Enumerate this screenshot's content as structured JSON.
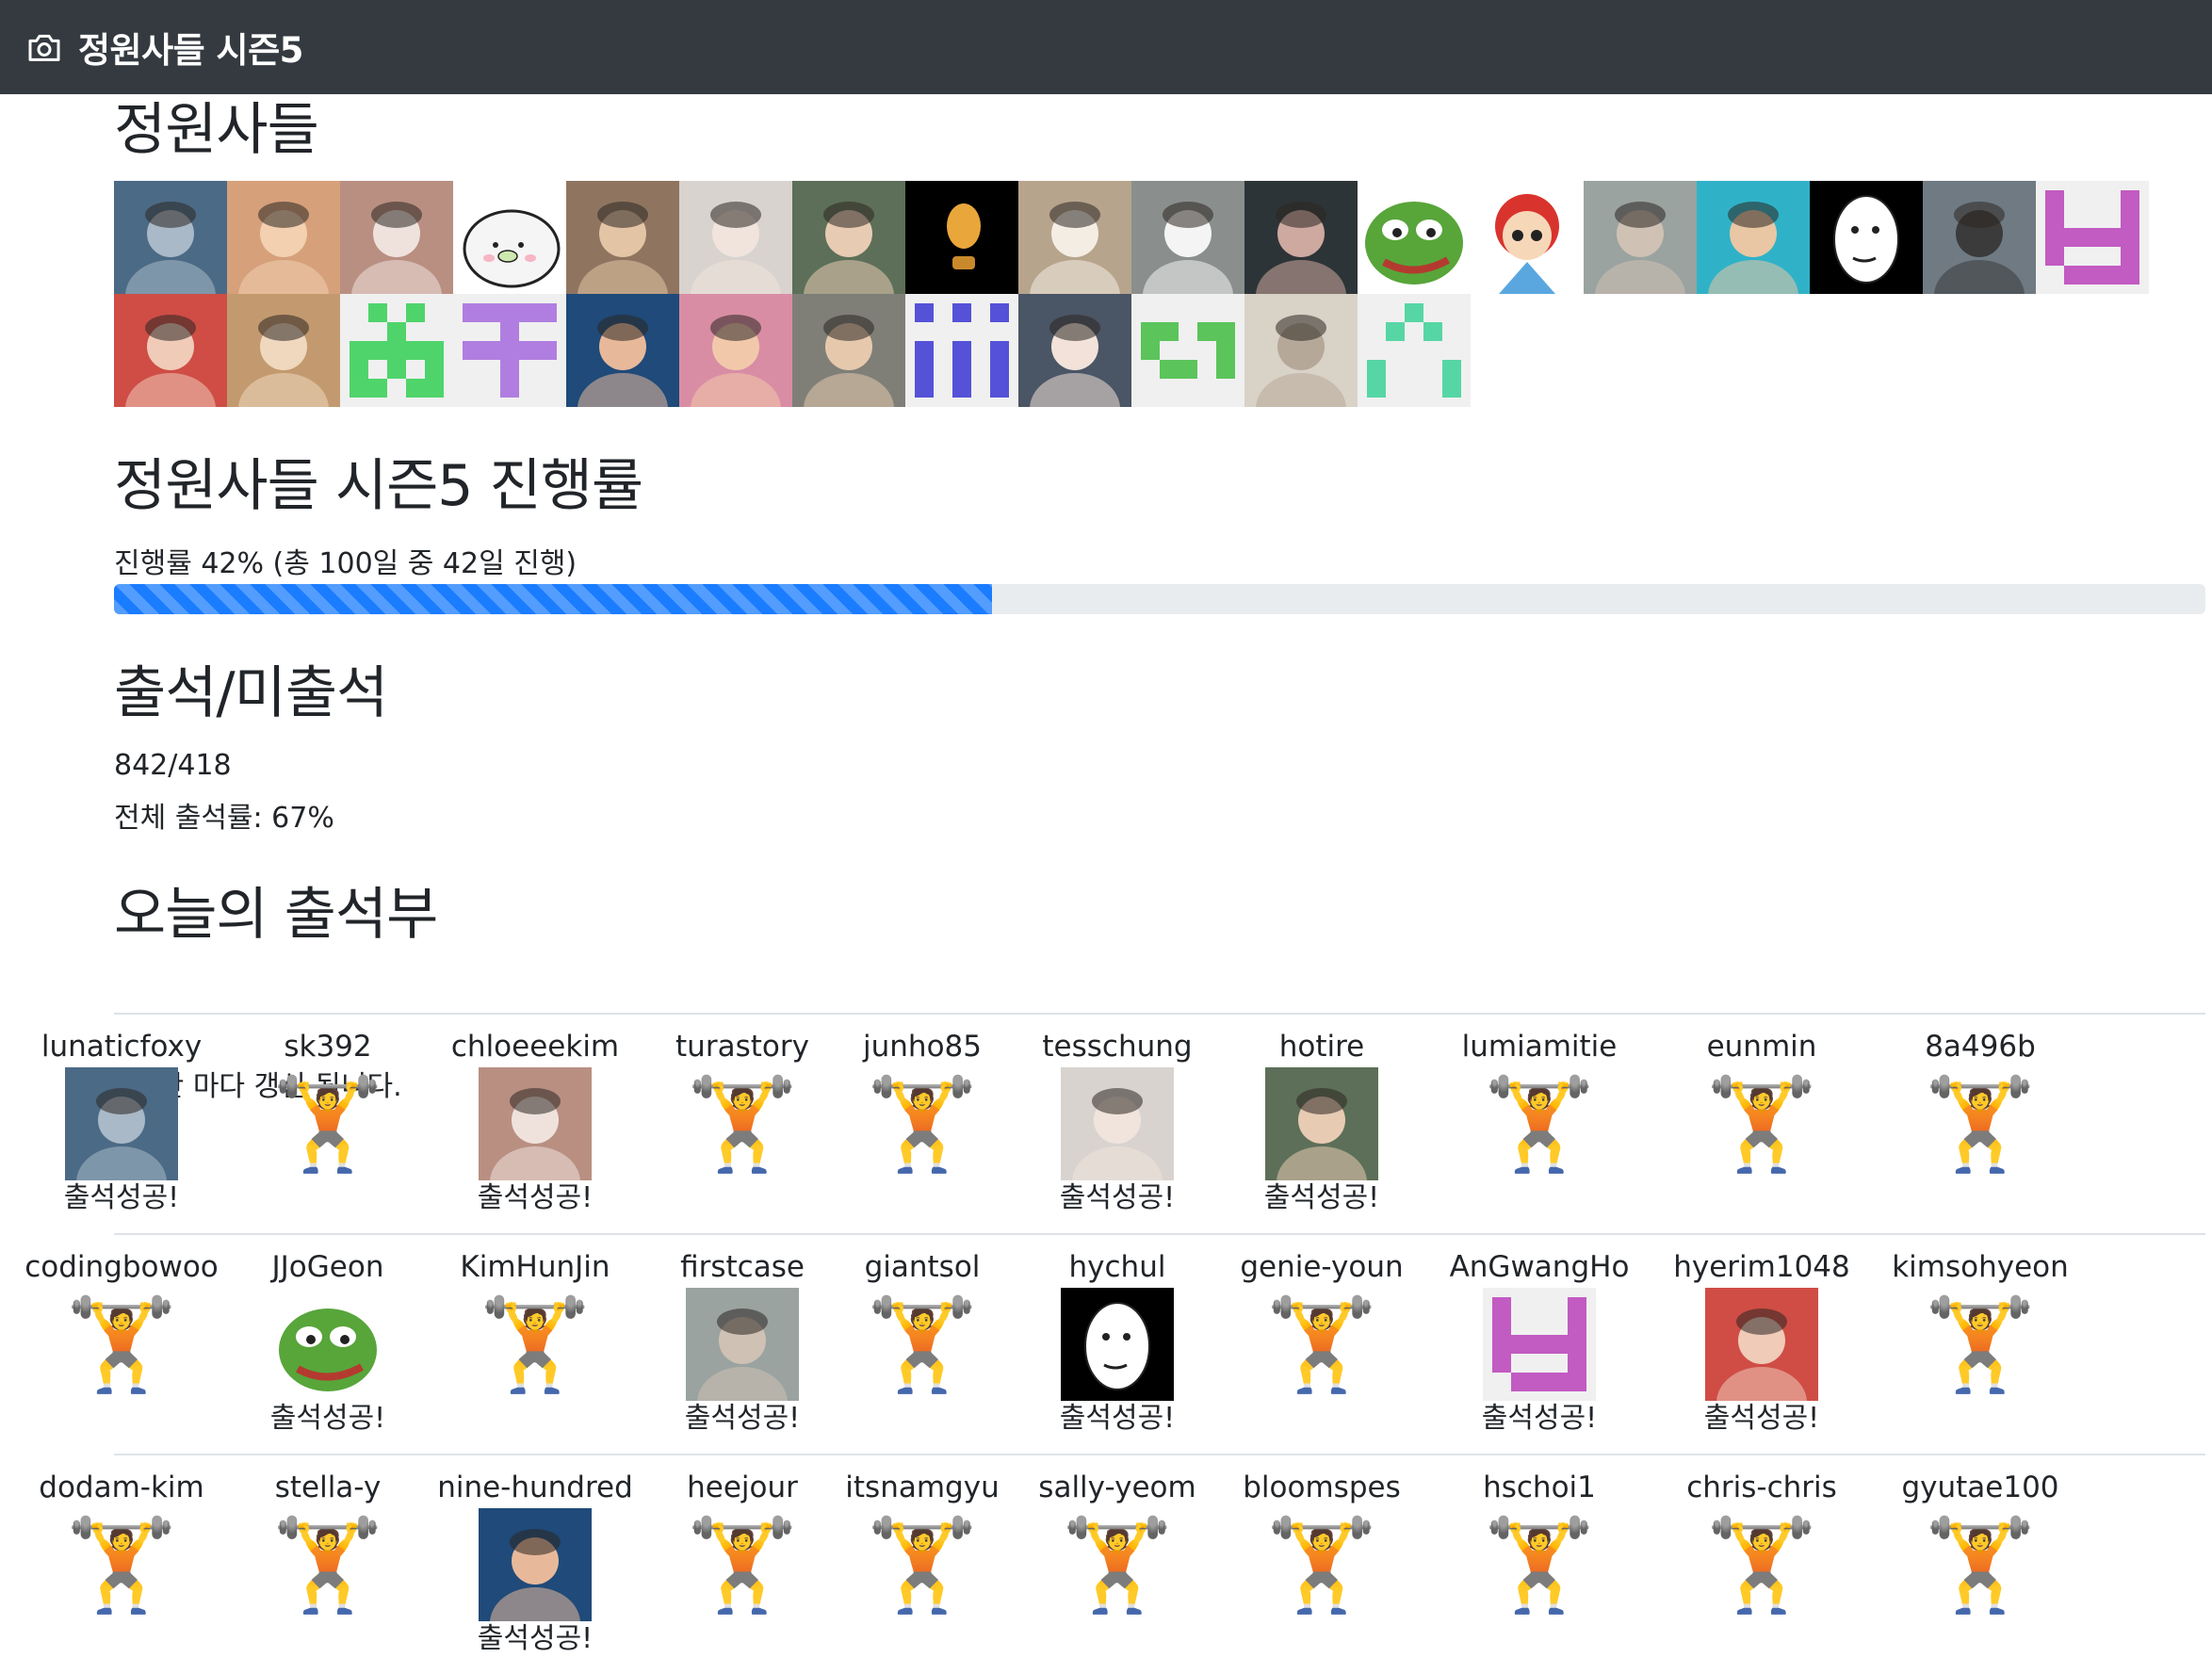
{
  "navbar": {
    "title": "정원사들 시즌5",
    "icon": "camera-icon"
  },
  "members": {
    "heading": "정원사들",
    "avatars": [
      {
        "kind": "photo",
        "bg": "#4b6a86",
        "fg": "#a9b9c7"
      },
      {
        "kind": "photo",
        "bg": "#d6a07a",
        "fg": "#f2d0b0"
      },
      {
        "kind": "photo",
        "bg": "#b98f82",
        "fg": "#efe2dc"
      },
      {
        "kind": "seal",
        "bg": "#ffffff",
        "fg": "#f2f2f2"
      },
      {
        "kind": "photo",
        "bg": "#8f7560",
        "fg": "#e3c4a4"
      },
      {
        "kind": "photo",
        "bg": "#d9d3cf",
        "fg": "#f1e4dc"
      },
      {
        "kind": "photo",
        "bg": "#5d6f58",
        "fg": "#e8cbb3"
      },
      {
        "kind": "dark",
        "bg": "#000000",
        "fg": "#e9a63a"
      },
      {
        "kind": "photo",
        "bg": "#b7a48d",
        "fg": "#f4ede4"
      },
      {
        "kind": "photo",
        "bg": "#8a8f8d",
        "fg": "#f4f4f4"
      },
      {
        "kind": "photo",
        "bg": "#2d3437",
        "fg": "#cda9a0"
      },
      {
        "kind": "pepe",
        "bg": "#ffffff",
        "fg": "#58a53a"
      },
      {
        "kind": "cartoon",
        "bg": "#ffffff",
        "fg": "#d9332d"
      },
      {
        "kind": "photo",
        "bg": "#9aa3a0",
        "fg": "#cfc1b4"
      },
      {
        "kind": "photo",
        "bg": "#2fb2c8",
        "fg": "#e9c6a4"
      },
      {
        "kind": "meme",
        "bg": "#000000",
        "fg": "#ffffff"
      },
      {
        "kind": "photo",
        "bg": "#6f7a83",
        "fg": "#3b3b3b"
      },
      {
        "kind": "identicon",
        "bg": "#f0f0f0",
        "fg": "#c25bc2",
        "pattern": "1000110001111111000101111"
      },
      {
        "kind": "photo",
        "bg": "#cf4d45",
        "fg": "#f0cbb8"
      },
      {
        "kind": "photo",
        "bg": "#c39a6f",
        "fg": "#efd8bd"
      },
      {
        "kind": "identicon",
        "bg": "#f0f0f0",
        "fg": "#4fd46b",
        "pattern": "0101000100111111010111011"
      },
      {
        "kind": "identicon",
        "bg": "#f0f0f0",
        "fg": "#b07ee0",
        "pattern": "1111100100111110010000100"
      },
      {
        "kind": "photo",
        "bg": "#1f4a79",
        "fg": "#e7b99a"
      },
      {
        "kind": "photo",
        "bg": "#d98da5",
        "fg": "#f2c8aa"
      },
      {
        "kind": "photo",
        "bg": "#7f7f78",
        "fg": "#e6c9ad"
      },
      {
        "kind": "identicon",
        "bg": "#f0f0f0",
        "fg": "#5552d8",
        "pattern": "1010100000101011010110101"
      },
      {
        "kind": "photo",
        "bg": "#4a5565",
        "fg": "#f2e2d9"
      },
      {
        "kind": "identicon",
        "bg": "#f0f0f0",
        "fg": "#5bc45b",
        "pattern": "0000011011100010110100000"
      },
      {
        "kind": "photo",
        "bg": "#d9d2c7",
        "fg": "#b6a898"
      },
      {
        "kind": "identicon",
        "bg": "#f0f0f0",
        "fg": "#56d6a4",
        "pattern": "0010001010000001000110001"
      }
    ]
  },
  "progress": {
    "heading": "정원사들 시즌5 진행률",
    "text": "진행률 42% (총 100일 중 42일 진행)",
    "percent": 42
  },
  "attendance": {
    "heading": "출석/미출석",
    "ratio": "842/418",
    "rate": "전체 출석률: 67%"
  },
  "today": {
    "heading": "오늘의 출석부",
    "note": "1시간 마다 갱신 됩니다.",
    "success_label": "출석성공!",
    "lifter": "🏋",
    "rows": [
      [
        {
          "name": "lunaticfoxy",
          "ok": true,
          "avatar": {
            "kind": "photo",
            "bg": "#4b6a86",
            "fg": "#a9b9c7"
          }
        },
        {
          "name": "sk392",
          "ok": false
        },
        {
          "name": "chloeeekim",
          "ok": true,
          "avatar": {
            "kind": "photo",
            "bg": "#b98f82",
            "fg": "#efe2dc"
          }
        },
        {
          "name": "turastory",
          "ok": false
        },
        {
          "name": "junho85",
          "ok": false
        },
        {
          "name": "tesschung",
          "ok": true,
          "avatar": {
            "kind": "photo",
            "bg": "#d9d3cf",
            "fg": "#f1e4dc"
          }
        },
        {
          "name": "hotire",
          "ok": true,
          "avatar": {
            "kind": "photo",
            "bg": "#5d6f58",
            "fg": "#e8cbb3"
          }
        },
        {
          "name": "lumiamitie",
          "ok": false
        },
        {
          "name": "eunmin",
          "ok": false
        },
        {
          "name": "8a496b",
          "ok": false
        }
      ],
      [
        {
          "name": "codingbowoo",
          "ok": false
        },
        {
          "name": "JJoGeon",
          "ok": true,
          "avatar": {
            "kind": "pepe",
            "bg": "#ffffff",
            "fg": "#58a53a"
          }
        },
        {
          "name": "KimHunJin",
          "ok": false
        },
        {
          "name": "firstcase",
          "ok": true,
          "avatar": {
            "kind": "photo",
            "bg": "#9aa3a0",
            "fg": "#cfc1b4"
          }
        },
        {
          "name": "giantsol",
          "ok": false
        },
        {
          "name": "hychul",
          "ok": true,
          "avatar": {
            "kind": "meme",
            "bg": "#000000",
            "fg": "#ffffff"
          }
        },
        {
          "name": "genie-youn",
          "ok": false
        },
        {
          "name": "AnGwangHo",
          "ok": true,
          "avatar": {
            "kind": "identicon",
            "bg": "#f0f0f0",
            "fg": "#c25bc2",
            "pattern": "1000110001111111000101111"
          }
        },
        {
          "name": "hyerim1048",
          "ok": true,
          "avatar": {
            "kind": "photo",
            "bg": "#cf4d45",
            "fg": "#f0cbb8"
          }
        },
        {
          "name": "kimsohyeon",
          "ok": false
        }
      ],
      [
        {
          "name": "dodam-kim",
          "ok": false
        },
        {
          "name": "stella-y",
          "ok": false
        },
        {
          "name": "nine-hundred",
          "ok": true,
          "avatar": {
            "kind": "photo",
            "bg": "#1f4a79",
            "fg": "#e7b99a"
          }
        },
        {
          "name": "heejour",
          "ok": false
        },
        {
          "name": "itsnamgyu",
          "ok": false
        },
        {
          "name": "sally-yeom",
          "ok": false
        },
        {
          "name": "bloomspes",
          "ok": false
        },
        {
          "name": "hschoi1",
          "ok": false
        },
        {
          "name": "chris-chris",
          "ok": false
        },
        {
          "name": "gyutae100",
          "ok": false
        }
      ]
    ]
  }
}
